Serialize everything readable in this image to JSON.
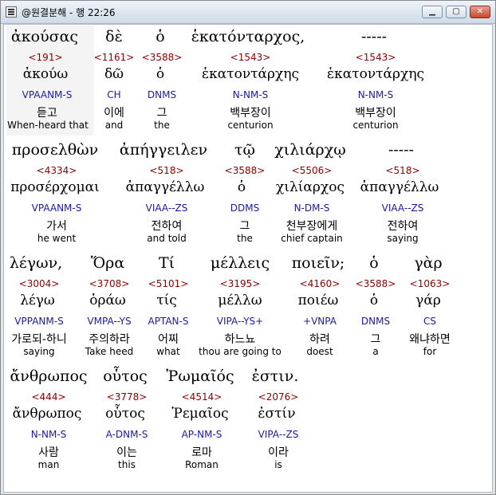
{
  "window": {
    "title": "@원결분해 - 행 22:26"
  },
  "rows": [
    {
      "tokens": [
        {
          "greek": "ἀκούσας",
          "strong": "<191>",
          "lemma": "ἀκούω",
          "parse": "VPAANM-S",
          "korean": "듣고",
          "english": "When-heard that"
        },
        {
          "greek": "δὲ",
          "strong": "<1161>",
          "lemma": "δῶ",
          "parse": "CH",
          "korean": "이에",
          "english": "and"
        },
        {
          "greek": "ὁ",
          "strong": "<3588>",
          "lemma": "ὁ",
          "parse": "DNMS",
          "korean": "그",
          "english": "the"
        },
        {
          "greek": "ἑκατόνταρχος,",
          "strong": "<1543>",
          "lemma": "ἑκατοντάρχης",
          "parse": "N-NM-S",
          "korean": "백부장이",
          "english": "centurion"
        },
        {
          "greek": "-----",
          "strong": "<1543>",
          "lemma": "ἑκατοντάρχης",
          "parse": "N-NM-S",
          "korean": "백부장이",
          "english": "centurion"
        }
      ]
    },
    {
      "tokens": [
        {
          "greek": "προσελθὼν",
          "strong": "<4334>",
          "lemma": "προσέρχομαι",
          "parse": "VPAANM-S",
          "korean": "가서",
          "english": "he went"
        },
        {
          "greek": "ἀπήγγειλεν",
          "strong": "<518>",
          "lemma": "ἀπαγγέλλω",
          "parse": "VIAA--ZS",
          "korean": "전하여",
          "english": "and told"
        },
        {
          "greek": "τῷ",
          "strong": "<3588>",
          "lemma": "ὁ",
          "parse": "DDMS",
          "korean": "그",
          "english": "the"
        },
        {
          "greek": "χιλιάρχῳ",
          "strong": "<5506>",
          "lemma": "χιλίαρχος",
          "parse": "N-DM-S",
          "korean": "천부장에게",
          "english": "chief captain"
        },
        {
          "greek": "-----",
          "strong": "<518>",
          "lemma": "ἀπαγγέλλω",
          "parse": "VIAA--ZS",
          "korean": "전하여",
          "english": "saying"
        }
      ]
    },
    {
      "tokens": [
        {
          "greek": "λέγων,",
          "strong": "<3004>",
          "lemma": "λέγω",
          "parse": "VPPANM-S",
          "korean": "가로되-하니",
          "english": "saying"
        },
        {
          "greek": "Ὅρα",
          "strong": "<3708>",
          "lemma": "ὁράω",
          "parse": "VMPA--YS",
          "korean": "주의하라",
          "english": "Take heed"
        },
        {
          "greek": "Τί",
          "strong": "<5101>",
          "lemma": "τίς",
          "parse": "APTAN-S",
          "korean": "어찌",
          "english": "what"
        },
        {
          "greek": "μέλλεις",
          "strong": "<3195>",
          "lemma": "μέλλω",
          "parse": "VIPA--YS+",
          "korean": "하느뇨",
          "english": "thou are going to"
        },
        {
          "greek": "ποιεῖν;",
          "strong": "<4160>",
          "lemma": "ποιέω",
          "parse": "+VNPA",
          "korean": "하려",
          "english": "doest"
        },
        {
          "greek": "ὁ",
          "strong": "<3588>",
          "lemma": "ὁ",
          "parse": "DNMS",
          "korean": "그",
          "english": "a"
        },
        {
          "greek": "γὰρ",
          "strong": "<1063>",
          "lemma": "γάρ",
          "parse": "CS",
          "korean": "왜냐하면",
          "english": "for"
        }
      ]
    },
    {
      "tokens": [
        {
          "greek": "ἄνθρωπος",
          "strong": "<444>",
          "lemma": "ἄνθρωπος",
          "parse": "N-NM-S",
          "korean": "사람",
          "english": "man"
        },
        {
          "greek": "οὗτος",
          "strong": "<3778>",
          "lemma": "οὗτος",
          "parse": "A-DNM-S",
          "korean": "이는",
          "english": "this"
        },
        {
          "greek": "Ῥωμαῖός",
          "strong": "<4514>",
          "lemma": "Ῥεμαῖος",
          "parse": "AP-NM-S",
          "korean": "로마",
          "english": "Roman"
        },
        {
          "greek": "ἐστιν.",
          "strong": "<2076>",
          "lemma": "ἐστίν",
          "parse": "VIPA--ZS",
          "korean": "이라",
          "english": "is"
        }
      ]
    }
  ]
}
